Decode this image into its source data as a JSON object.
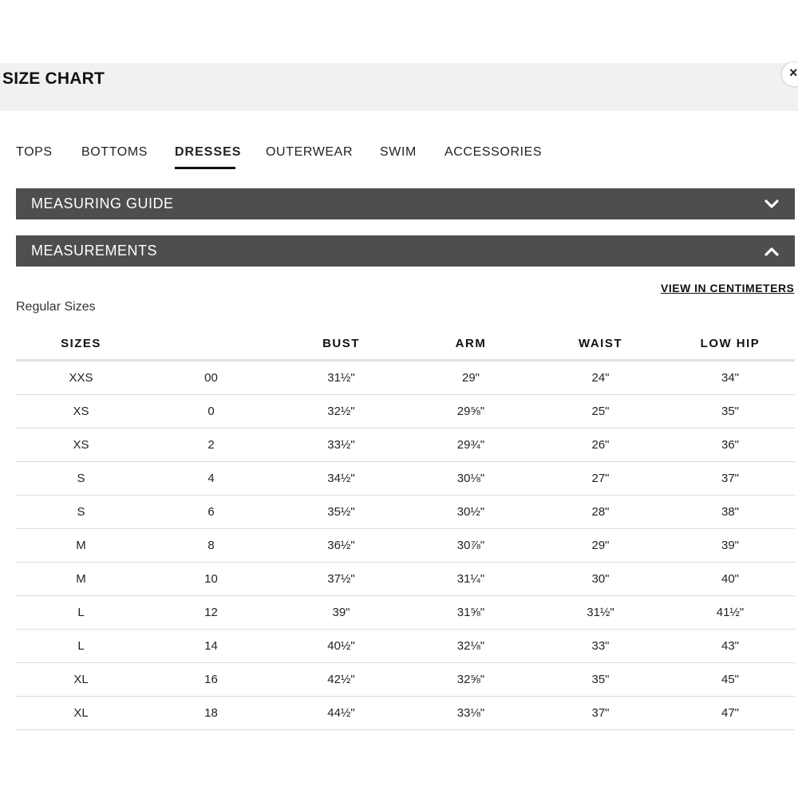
{
  "header": {
    "title": "SIZE CHART",
    "close_label": "×"
  },
  "tabs": [
    {
      "label": "TOPS"
    },
    {
      "label": "BOTTOMS"
    },
    {
      "label": "DRESSES"
    },
    {
      "label": "OUTERWEAR"
    },
    {
      "label": "SWIM"
    },
    {
      "label": "ACCESSORIES"
    }
  ],
  "active_tab": "DRESSES",
  "accordions": {
    "measuring_guide": {
      "label": "MEASURING GUIDE",
      "expanded": false
    },
    "measurements": {
      "label": "MEASUREMENTS",
      "expanded": true
    }
  },
  "units_link": "VIEW IN CENTIMETERS",
  "section_label": "Regular Sizes",
  "table": {
    "headers": [
      "SIZES",
      "",
      "BUST",
      "ARM",
      "WAIST",
      "LOW HIP"
    ],
    "rows": [
      [
        "XXS",
        "00",
        "31½\"",
        "29\"",
        "24\"",
        "34\""
      ],
      [
        "XS",
        "0",
        "32½\"",
        "29⅝\"",
        "25\"",
        "35\""
      ],
      [
        "XS",
        "2",
        "33½\"",
        "29¾\"",
        "26\"",
        "36\""
      ],
      [
        "S",
        "4",
        "34½\"",
        "30⅛\"",
        "27\"",
        "37\""
      ],
      [
        "S",
        "6",
        "35½\"",
        "30½\"",
        "28\"",
        "38\""
      ],
      [
        "M",
        "8",
        "36½\"",
        "30⅞\"",
        "29\"",
        "39\""
      ],
      [
        "M",
        "10",
        "37½\"",
        "31¼\"",
        "30\"",
        "40\""
      ],
      [
        "L",
        "12",
        "39\"",
        "31⅝\"",
        "31½\"",
        "41½\""
      ],
      [
        "L",
        "14",
        "40½\"",
        "32⅛\"",
        "33\"",
        "43\""
      ],
      [
        "XL",
        "16",
        "42½\"",
        "32⅝\"",
        "35\"",
        "45\""
      ],
      [
        "XL",
        "18",
        "44½\"",
        "33⅛\"",
        "37\"",
        "47\""
      ]
    ]
  },
  "colors": {
    "accordion_bg": "#4e4e4e",
    "header_bg": "#f1f1f1",
    "active_underline": "#111111"
  },
  "icons": {
    "close": "close-icon",
    "collapsed": "chevron-down-icon",
    "expanded": "chevron-up-icon"
  }
}
